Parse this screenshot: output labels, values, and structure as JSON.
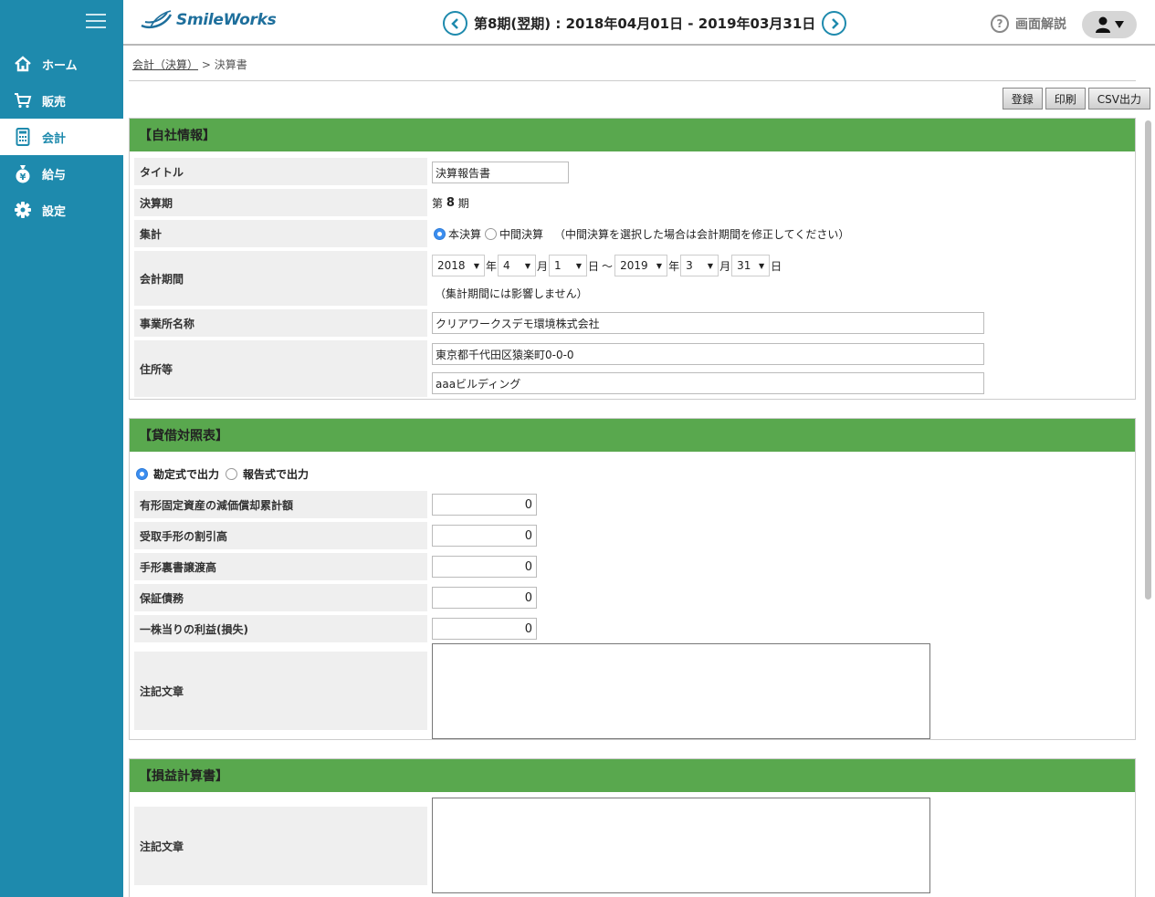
{
  "app": {
    "logo_text": "SmileWorks"
  },
  "header": {
    "period": "第8期(翌期) : 2018年04月01日 - 2019年03月31日",
    "help_label": "画面解説",
    "colors": {
      "accent": "#1e8aad",
      "section": "#59a84e"
    }
  },
  "sidebar": {
    "items": [
      {
        "label": "ホーム",
        "icon": "home-icon"
      },
      {
        "label": "販売",
        "icon": "cart-icon"
      },
      {
        "label": "会計",
        "icon": "calculator-icon",
        "active": true
      },
      {
        "label": "給与",
        "icon": "yen-bag-icon"
      },
      {
        "label": "設定",
        "icon": "gear-icon"
      }
    ]
  },
  "breadcrumb": {
    "parent": "会計（決算）",
    "separator": ">",
    "current": "決算書"
  },
  "toolbar": {
    "register": "登録",
    "print": "印刷",
    "csv": "CSV出力"
  },
  "company": {
    "header": "【自社情報】",
    "title_label": "タイトル",
    "title_value": "決算報告書",
    "term_label": "決算期",
    "term_prefix": "第",
    "term_value": "8",
    "term_suffix": "期",
    "tally_label": "集計",
    "tally_options": [
      "本決算",
      "中間決算"
    ],
    "tally_note": "（中間決算を選択した場合は会計期間を修正してください）",
    "period_label": "会計期間",
    "period": {
      "start_year": "2018",
      "start_month": "4",
      "start_day": "1",
      "end_year": "2019",
      "end_month": "3",
      "end_day": "31",
      "year_unit": "年",
      "month_unit": "月",
      "day_unit": "日",
      "tilde": "〜"
    },
    "period_note": "（集計期間には影響しません）",
    "office_label": "事業所名称",
    "office_value": "クリアワークスデモ環境株式会社",
    "address_label": "住所等",
    "address_line1": "東京都千代田区猿楽町0-0-0",
    "address_line2": "aaaビルディング"
  },
  "balance": {
    "header": "【貸借対照表】",
    "output_options": [
      "勘定式で出力",
      "報告式で出力"
    ],
    "rows": [
      {
        "label": "有形固定資産の減価償却累計額",
        "value": "0"
      },
      {
        "label": "受取手形の割引高",
        "value": "0"
      },
      {
        "label": "手形裏書譲渡高",
        "value": "0"
      },
      {
        "label": "保証債務",
        "value": "0"
      },
      {
        "label": "一株当りの利益(損失)",
        "value": "0"
      }
    ],
    "note_label": "注記文章"
  },
  "income": {
    "header": "【損益計算書】",
    "note_label": "注記文章"
  }
}
